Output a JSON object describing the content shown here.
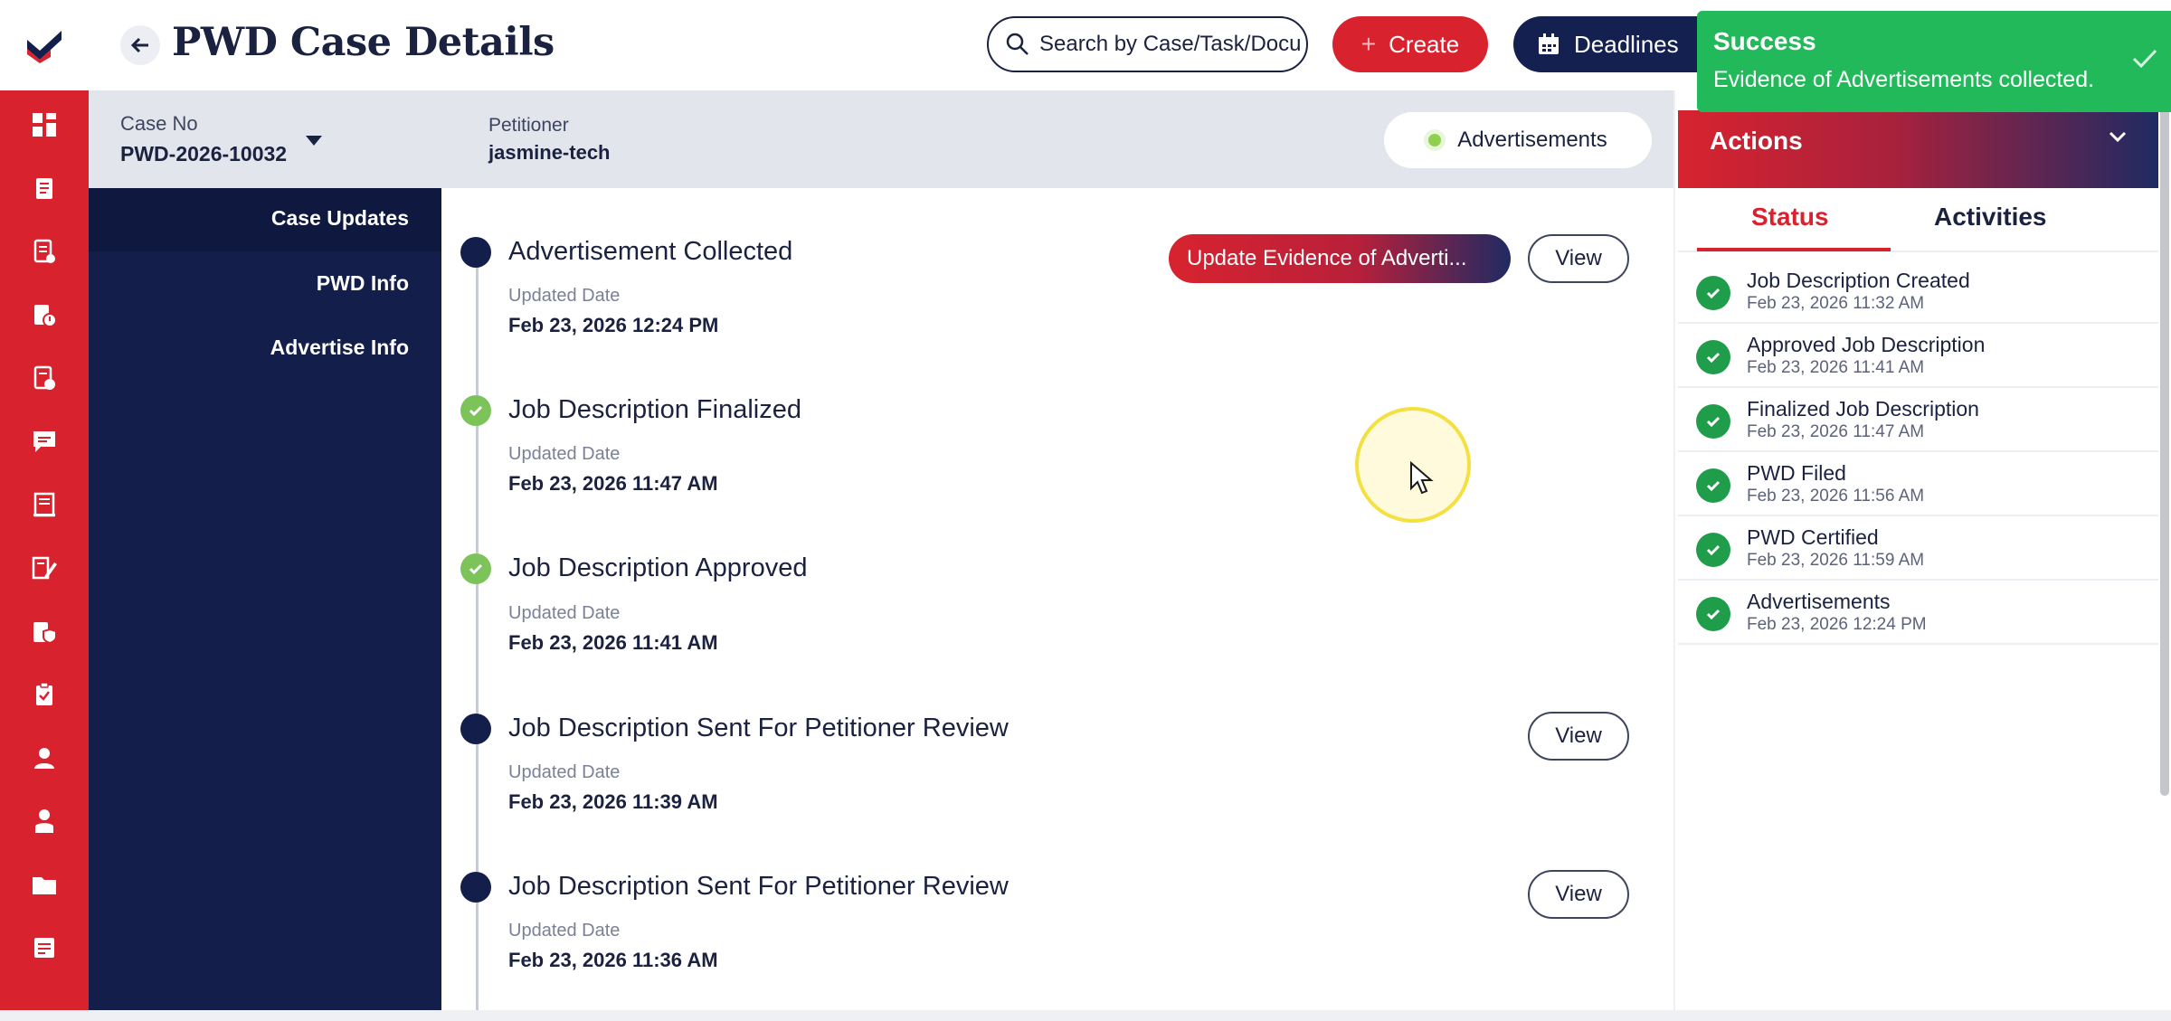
{
  "header": {
    "title": "PWD Case Details",
    "search_placeholder": "Search by Case/Task/Docu",
    "create_label": "Create",
    "deadlines_label": "Deadlines"
  },
  "case": {
    "case_no_label": "Case No",
    "case_no": "PWD-2026-10032",
    "petitioner_label": "Petitioner",
    "petitioner": "jasmine-tech",
    "stage": "Advertisements"
  },
  "section_nav": [
    {
      "label": "Case Updates"
    },
    {
      "label": "PWD Info"
    },
    {
      "label": "Advertise Info"
    }
  ],
  "timeline": {
    "updated_label": "Updated Date",
    "items": [
      {
        "title": "Advertisement Collected",
        "date": "Feb 23, 2026 12:24 PM",
        "action": "Update Evidence of Adverti...",
        "view": "View"
      },
      {
        "title": "Job Description Finalized",
        "date": "Feb 23, 2026 11:47 AM"
      },
      {
        "title": "Job Description Approved",
        "date": "Feb 23, 2026 11:41 AM"
      },
      {
        "title": "Job Description Sent For Petitioner Review",
        "date": "Feb 23, 2026 11:39 AM",
        "view": "View"
      },
      {
        "title": "Job Description Sent For Petitioner Review",
        "date": "Feb 23, 2026 11:36 AM",
        "view": "View"
      }
    ]
  },
  "actions": {
    "title": "Actions",
    "tabs": [
      {
        "label": "Status"
      },
      {
        "label": "Activities"
      }
    ],
    "status_items": [
      {
        "name": "Job Description Created",
        "time": "Feb 23, 2026 11:32 AM"
      },
      {
        "name": "Approved Job Description",
        "time": "Feb 23, 2026 11:41 AM"
      },
      {
        "name": "Finalized Job Description",
        "time": "Feb 23, 2026 11:47 AM"
      },
      {
        "name": "PWD Filed",
        "time": "Feb 23, 2026 11:56 AM"
      },
      {
        "name": "PWD Certified",
        "time": "Feb 23, 2026 11:59 AM"
      },
      {
        "name": "Advertisements",
        "time": "Feb 23, 2026 12:24 PM"
      }
    ]
  },
  "toast": {
    "title": "Success",
    "message": "Evidence of Advertisements collected."
  },
  "colors": {
    "brand_red": "#d8232f",
    "brand_navy": "#131e4a",
    "success_green": "#22b95a",
    "status_green": "#1f9d4b",
    "timeline_check": "#7cc35a"
  },
  "icons": {
    "rail": [
      "dashboard-icon",
      "document-icon",
      "checklist-icon",
      "file-alert-icon",
      "file-check-icon",
      "chat-icon",
      "notebook-icon",
      "edit-list-icon",
      "file-shield-icon",
      "clipboard-icon",
      "user-icon",
      "person-icon",
      "folder-icon",
      "notes-icon"
    ]
  }
}
